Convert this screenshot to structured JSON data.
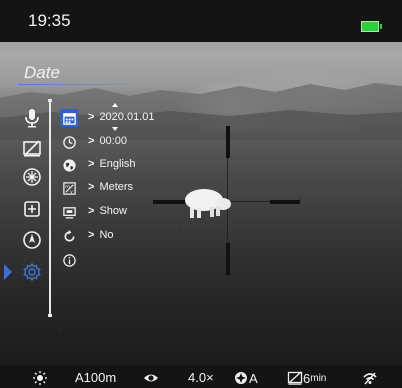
{
  "status": {
    "time": "19:35",
    "battery_color": "#2fcf3c"
  },
  "menu_title": "Date",
  "left_menu": [
    {
      "icon": "microphone-icon"
    },
    {
      "icon": "display-off-icon"
    },
    {
      "icon": "aperture-icon"
    },
    {
      "icon": "add-square-icon"
    },
    {
      "icon": "compass-icon"
    },
    {
      "icon": "settings-gear-icon",
      "active": true
    }
  ],
  "settings": [
    {
      "icon": "calendar-icon",
      "value": "2020.01.01",
      "selected": true
    },
    {
      "icon": "clock-icon",
      "value": "00:00"
    },
    {
      "icon": "globe-icon",
      "value": "English"
    },
    {
      "icon": "units-icon",
      "value": "Meters"
    },
    {
      "icon": "display-icon",
      "value": "Show"
    },
    {
      "icon": "reset-icon",
      "value": "No"
    },
    {
      "icon": "info-icon"
    }
  ],
  "bottom_bar": {
    "distance": "A100m",
    "zoom": "4.0×",
    "ir_mode": "A",
    "display_timeout": "6",
    "display_timeout_unit": "min"
  },
  "accent_color": "#2f62c7"
}
